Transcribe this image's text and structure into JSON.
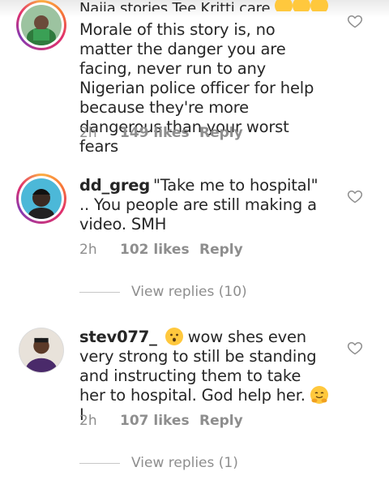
{
  "comments": [
    {
      "cut_line": "Naija stories Tee Kritti care",
      "text": "Morale of this story is, no matter the danger you are facing, never run to any Nigerian police officer for help because they're more dangerous than your worst fears",
      "time": "2h",
      "likes": "149 likes",
      "reply": "Reply"
    },
    {
      "username": "dd_greg",
      "text": "\"Take me to hospital\" .. You people are still making a video. SMH",
      "time": "2h",
      "likes": "102 likes",
      "reply": "Reply",
      "view_replies": "View replies (10)"
    },
    {
      "username": "stev077_",
      "text_a": "wow shes even very strong to still be standing and instructing them to take her to hospital. God help her.",
      "text_b": "I",
      "time": "2h",
      "likes": "107 likes",
      "reply": "Reply",
      "view_replies": "View replies (1)"
    }
  ],
  "icons": {
    "like": "heart-outline-icon",
    "emoji_1": "hushed-face-emoji",
    "emoji_2": "hugging-face-emoji",
    "emoji_cut": "smiling-face-emoji"
  },
  "colors": {
    "text": "#262626",
    "meta": "#8e8e8e",
    "story_ring_start": "#fcaf45",
    "story_ring_end": "#833ab4"
  }
}
